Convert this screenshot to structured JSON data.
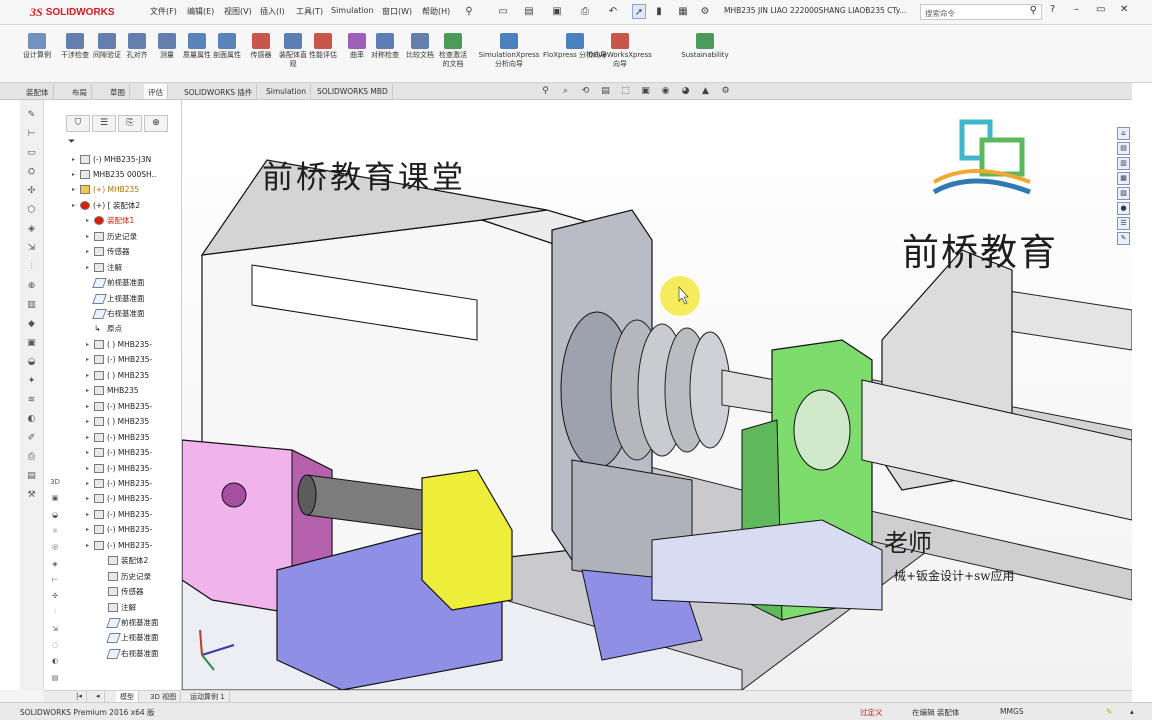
{
  "app": {
    "brand": "SOLIDWORKS",
    "doc_title": "MHB235 JIN LIAO 222000SHANG LIAOB235 CTy...",
    "search_placeholder": "搜索命令"
  },
  "menu": [
    "文件(F)",
    "编辑(E)",
    "视图(V)",
    "插入(I)",
    "工具(T)",
    "Simulation",
    "窗口(W)",
    "帮助(H)"
  ],
  "command_manager": {
    "tools": [
      {
        "label": "设计算例",
        "icon": "design-study-icon",
        "color": "#5b7fb5"
      },
      {
        "label": "干涉检查",
        "icon": "interference-check-icon",
        "color": "#4a6aa0"
      },
      {
        "label": "间隙验证",
        "icon": "clearance-verification-icon",
        "color": "#4a6aa0"
      },
      {
        "label": "孔对齐",
        "icon": "hole-alignment-icon",
        "color": "#4a6aa0"
      },
      {
        "label": "测量",
        "icon": "measure-icon",
        "color": "#4a6aa0"
      },
      {
        "label": "质量属性",
        "icon": "mass-properties-icon",
        "color": "#3f6fb0"
      },
      {
        "label": "剖面属性",
        "icon": "section-properties-icon",
        "color": "#3f6fb0"
      },
      {
        "label": "传感器",
        "icon": "sensor-icon",
        "color": "#c0392b"
      },
      {
        "label": "装配体直观",
        "icon": "assembly-visualization-icon",
        "color": "#4169a8"
      },
      {
        "label": "性能评估",
        "icon": "performance-evaluation-icon",
        "color": "#c0392b"
      },
      {
        "label": "曲率",
        "icon": "curvature-icon",
        "color": "#8e44ad"
      },
      {
        "label": "对称检查",
        "icon": "symmetry-check-icon",
        "color": "#4169a8"
      },
      {
        "label": "比较文档",
        "icon": "compare-documents-icon",
        "color": "#4a6aa0"
      },
      {
        "label": "检查激活的文档",
        "icon": "check-active-document-icon",
        "color": "#2d8a3e"
      },
      {
        "label": "SimulationXpress 分析向导",
        "icon": "simulationxpress-icon",
        "color": "#2d6cb5"
      },
      {
        "label": "FloXpress 分析向导",
        "icon": "floxpress-icon",
        "color": "#2d6cb5"
      },
      {
        "label": "DriveWorksXpress 向导",
        "icon": "driveworksxpress-icon",
        "color": "#c0392b"
      },
      {
        "label": "Sustainability",
        "icon": "sustainability-icon",
        "color": "#2d8a3e"
      }
    ]
  },
  "tabs": [
    "装配体",
    "布局",
    "草图",
    "评估",
    "SOLIDWORKS 插件",
    "Simulation",
    "SOLIDWORKS MBD"
  ],
  "active_tab": "评估",
  "feature_tree": {
    "rows": [
      {
        "label": "(-) MHB235-J3N",
        "depth": 0,
        "icon": "part"
      },
      {
        "label": "MHB235 000SH..",
        "depth": 0,
        "icon": "part"
      },
      {
        "label": "(+) MHB235",
        "depth": 0,
        "icon": "warn-part"
      },
      {
        "label": "(+) [ 装配体2",
        "depth": 0,
        "icon": "error-assembly"
      },
      {
        "label": "装配体1",
        "depth": 1,
        "icon": "error"
      },
      {
        "label": "历史记录",
        "depth": 1,
        "icon": "history"
      },
      {
        "label": "传感器",
        "depth": 1,
        "icon": "sensor"
      },
      {
        "label": "注解",
        "depth": 1,
        "icon": "annotation"
      },
      {
        "label": "前视基准面",
        "depth": 1,
        "icon": "plane"
      },
      {
        "label": "上视基准面",
        "depth": 1,
        "icon": "plane"
      },
      {
        "label": "右视基准面",
        "depth": 1,
        "icon": "plane"
      },
      {
        "label": "原点",
        "depth": 1,
        "icon": "origin"
      },
      {
        "label": "( ) MHB235-",
        "depth": 1,
        "icon": "part"
      },
      {
        "label": "(-) MHB235-",
        "depth": 1,
        "icon": "part"
      },
      {
        "label": "( ) MHB235",
        "depth": 1,
        "icon": "part"
      },
      {
        "label": "MHB235",
        "depth": 1,
        "icon": "part"
      },
      {
        "label": "(-) MHB235-",
        "depth": 1,
        "icon": "part"
      },
      {
        "label": "( ) MHB235",
        "depth": 1,
        "icon": "part"
      },
      {
        "label": "(-) MHB235",
        "depth": 1,
        "icon": "part"
      },
      {
        "label": "(-) MHB235-",
        "depth": 1,
        "icon": "part"
      },
      {
        "label": "(-) MHB235-",
        "depth": 1,
        "icon": "part"
      },
      {
        "label": "(-) MHB235-",
        "depth": 1,
        "icon": "part"
      },
      {
        "label": "(-) MHB235-",
        "depth": 1,
        "icon": "part"
      },
      {
        "label": "(-) MHB235-",
        "depth": 1,
        "icon": "part"
      },
      {
        "label": "(-) MHB235-",
        "depth": 1,
        "icon": "part"
      },
      {
        "label": "(-) MHB235-",
        "depth": 1,
        "icon": "assembly"
      },
      {
        "label": "装配体2",
        "depth": 2,
        "icon": "assembly"
      },
      {
        "label": "历史记录",
        "depth": 2,
        "icon": "history"
      },
      {
        "label": "传感器",
        "depth": 2,
        "icon": "sensor"
      },
      {
        "label": "注解",
        "depth": 2,
        "icon": "annotation"
      },
      {
        "label": "前视基准面",
        "depth": 2,
        "icon": "plane"
      },
      {
        "label": "上视基准面",
        "depth": 2,
        "icon": "plane"
      },
      {
        "label": "右视基准面",
        "depth": 2,
        "icon": "plane"
      }
    ]
  },
  "viewport": {
    "watermark_title": "前桥教育课堂",
    "watermark_brand": "前桥教育",
    "watermark_teacher": "老师",
    "watermark_tagline": "械+钣金设计+sw应用",
    "heads_up_icons": [
      "zoom-fit-icon",
      "zoom-area-icon",
      "previous-view-icon",
      "section-view-icon",
      "view-orientation-icon",
      "display-style-icon",
      "hide-show-icon",
      "appearance-icon",
      "scene-icon",
      "view-settings-icon"
    ]
  },
  "bottom_tabs": [
    "模型",
    "3D 视图",
    "运动算例 1"
  ],
  "active_bottom_tab": "模型",
  "status": {
    "app_version": "SOLIDWORKS Premium 2016 x64 版",
    "definition": "过定义",
    "editing": "在编辑 装配体",
    "units": "MMGS"
  }
}
